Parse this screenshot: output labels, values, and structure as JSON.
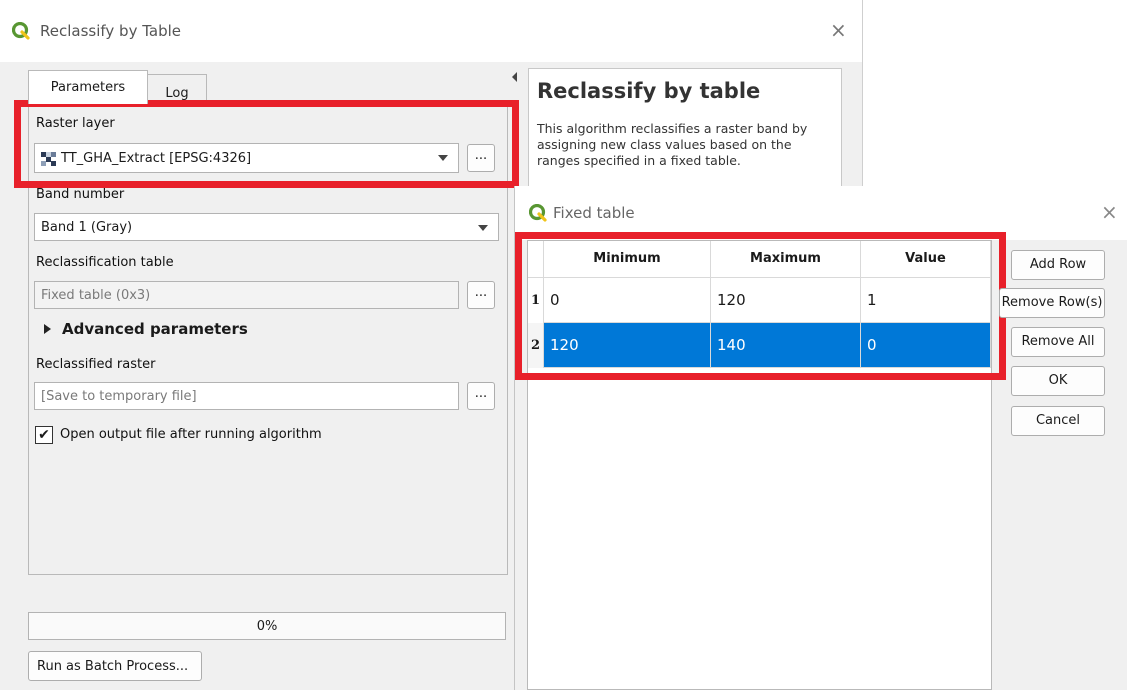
{
  "main": {
    "title": "Reclassify by Table",
    "close_glyph": "×",
    "tabs": [
      {
        "label": "Parameters"
      },
      {
        "label": "Log"
      }
    ],
    "raster_layer": {
      "label": "Raster layer",
      "value": "TT_GHA_Extract [EPSG:4326]",
      "browse": "..."
    },
    "band": {
      "label": "Band number",
      "value": "Band 1 (Gray)"
    },
    "reclass_table": {
      "label": "Reclassification table",
      "value": "Fixed table (0x3)",
      "browse": "..."
    },
    "advanced": {
      "label": "Advanced parameters"
    },
    "output": {
      "label": "Reclassified raster",
      "placeholder": "[Save to temporary file]",
      "browse": "..."
    },
    "open_output": {
      "label": "Open output file after running algorithm",
      "checked": true
    },
    "progress": {
      "text": "0%",
      "value": 0
    },
    "batch_button": "Run as Batch Process..."
  },
  "help": {
    "title": "Reclassify by table",
    "text": "This algorithm reclassifies a raster band by assigning new class values based on the ranges specified in a fixed table."
  },
  "fixed_table": {
    "title": "Fixed table",
    "close_glyph": "×",
    "columns": [
      "Minimum",
      "Maximum",
      "Value"
    ],
    "rows": [
      {
        "num": "1",
        "cells": [
          "0",
          "120",
          "1"
        ],
        "selected": false
      },
      {
        "num": "2",
        "cells": [
          "120",
          "140",
          "0"
        ],
        "selected": true
      }
    ],
    "buttons": {
      "add_row": "Add Row",
      "remove_rows": "Remove Row(s)",
      "remove_all": "Remove All",
      "ok": "OK",
      "cancel": "Cancel"
    }
  },
  "colors": {
    "highlight": "#e8202a",
    "selection": "#0078d7",
    "qgis_green": "#589632"
  }
}
